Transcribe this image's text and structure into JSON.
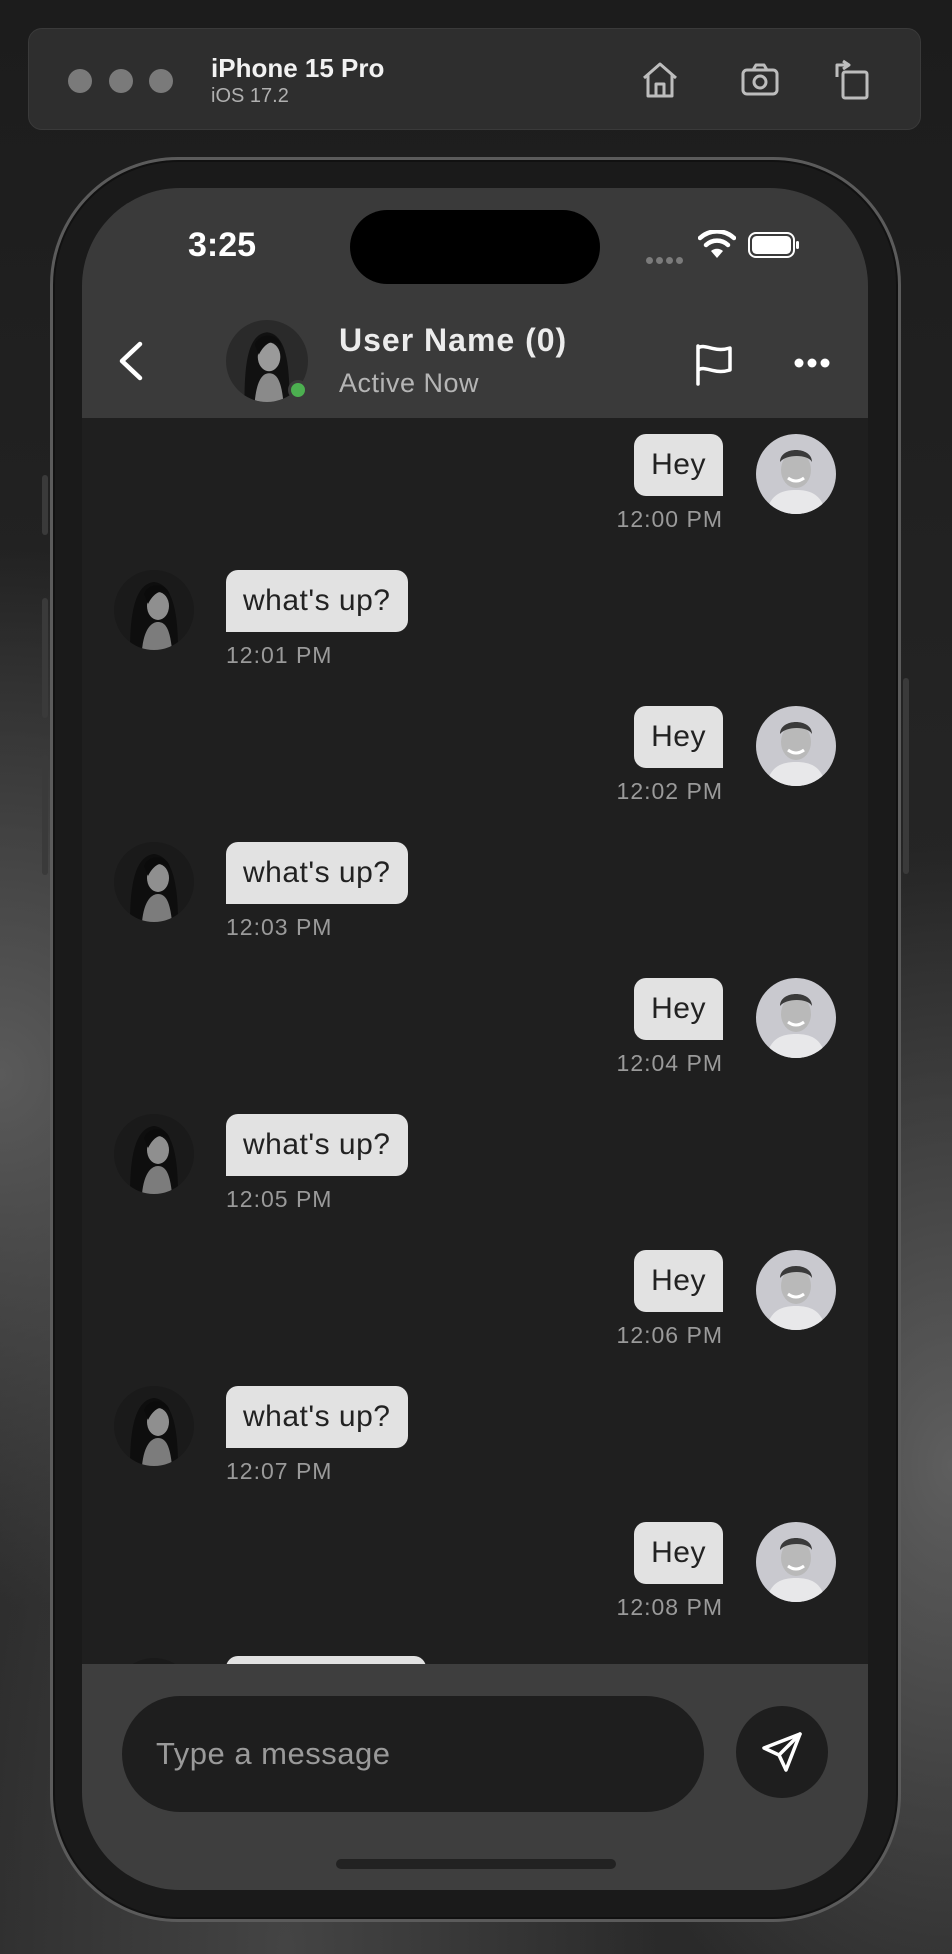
{
  "simulator": {
    "device_name": "iPhone 15 Pro",
    "os_version": "iOS 17.2",
    "icons": [
      "home-icon",
      "screenshot-icon",
      "rotate-icon"
    ]
  },
  "status_bar": {
    "time": "3:25"
  },
  "chat_header": {
    "user_name": "User Name (0)",
    "status": "Active Now",
    "online_color": "#4caf50"
  },
  "messages": [
    {
      "text": "Hey",
      "time": "12:00 PM",
      "direction": "outgoing"
    },
    {
      "text": "what's up?",
      "time": "12:01 PM",
      "direction": "incoming"
    },
    {
      "text": "Hey",
      "time": "12:02 PM",
      "direction": "outgoing"
    },
    {
      "text": "what's up?",
      "time": "12:03 PM",
      "direction": "incoming"
    },
    {
      "text": "Hey",
      "time": "12:04 PM",
      "direction": "outgoing"
    },
    {
      "text": "what's up?",
      "time": "12:05 PM",
      "direction": "incoming"
    },
    {
      "text": "Hey",
      "time": "12:06 PM",
      "direction": "outgoing"
    },
    {
      "text": "what's up?",
      "time": "12:07 PM",
      "direction": "incoming"
    },
    {
      "text": "Hey",
      "time": "12:08 PM",
      "direction": "outgoing"
    }
  ],
  "composer": {
    "placeholder": "Type a message",
    "value": ""
  },
  "colors": {
    "bubble": "#e2e2e2",
    "chat_background": "#1f1f1f",
    "header_background": "#3a3a3a"
  }
}
